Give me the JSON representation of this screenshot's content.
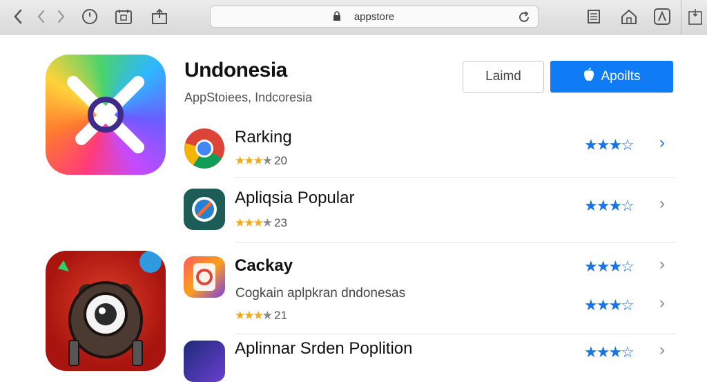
{
  "browser": {
    "url": "appstore",
    "icons": [
      "back-icon",
      "back-disabled-icon",
      "forward-icon",
      "history-icon",
      "calendar-icon",
      "share-icon",
      "lock-icon",
      "reload-icon",
      "reader-icon",
      "home-icon",
      "bookmark-icon",
      "sidebar-icon"
    ]
  },
  "header": {
    "title": "Undonesia",
    "subtitle": "AppStoiees, Indcoresia",
    "secondary_button": "Laimd",
    "primary_button": "Apoilts"
  },
  "list": [
    {
      "name": "Rarking",
      "rating_text": "20",
      "stars": 3.5
    },
    {
      "name": "Apliqsia Popular",
      "rating_text": "23",
      "stars": 3.5
    },
    {
      "name": "Cackay",
      "stars": 3.5
    },
    {
      "description": "Cogkain aplpkran dndonesas",
      "rating_text": "21",
      "stars": 3.5
    },
    {
      "name": "Aplinnar Srden Poplition",
      "stars": 3.5
    }
  ],
  "colors": {
    "accent": "#0f7bf5",
    "star_blue": "#1a73e8",
    "star_yellow": "#f2a91c"
  }
}
